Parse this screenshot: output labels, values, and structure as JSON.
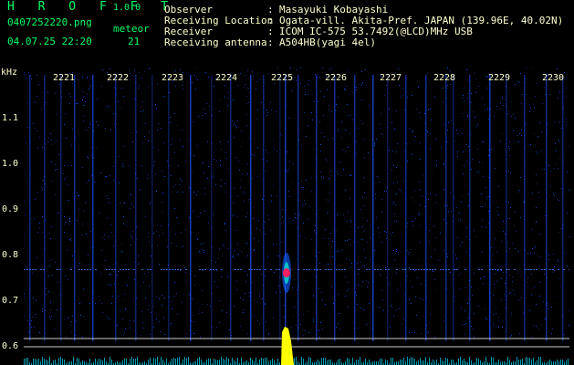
{
  "header": {
    "app_name": "H R O F F T",
    "version": "1.0.0",
    "filename": "0407252220.png",
    "datetime": "04.07.25 22:20",
    "meteor_label": "meteor",
    "meteor_count": "21",
    "observer_label": "Observer",
    "observer_value": "Masayuki Kobayashi",
    "location_label": "Receiving Location",
    "location_value": "Ogata-vill. Akita-Pref. JAPAN (139.96E, 40.02N)",
    "receiver_label": "Receiver",
    "receiver_value": "ICOM IC-575 53.7492(@LCD)MHz USB",
    "antenna_label": "Receiving antenna",
    "antenna_value": "A504HB(yagi 4el)",
    "separator": ":"
  },
  "axes": {
    "y_unit": "kHz",
    "y_ticks": [
      "1.1",
      "1.0",
      "0.9",
      "0.8",
      "0.7",
      "0.6"
    ],
    "x_ticks": [
      "2221",
      "2222",
      "2223",
      "2224",
      "2225",
      "2226",
      "2227",
      "2228",
      "2229",
      "2230"
    ]
  },
  "colors": {
    "background": "#000000",
    "header_green": "#00ff66",
    "header_text": "#ffffcc",
    "noise_blue": "#1a3cff",
    "echo_yellow": "#ffff00",
    "echo_red": "#ff2060"
  }
}
